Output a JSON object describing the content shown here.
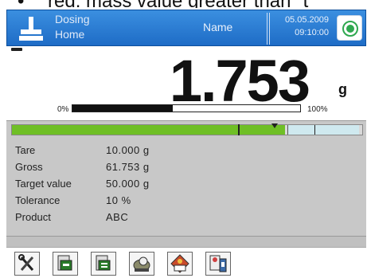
{
  "caption": {
    "bullet": "•",
    "text": "red: mass value greater than \"t"
  },
  "header": {
    "mode_line1": "Dosing",
    "mode_line2": "Home",
    "name_label": "Name",
    "date": "05.05.2009",
    "time": "09:10:00",
    "status_color": "#2fa84f",
    "icon": "scale-weighing-icon"
  },
  "display": {
    "value": "1.753",
    "unit": "g",
    "bar_min_label": "0%",
    "bar_max_label": "100%",
    "bar_fill_fraction": 0.44
  },
  "threshold_bar": {
    "green_fraction": 0.78,
    "colors": {
      "progress": "#6fbf26",
      "target_zone": "#cfe9ef"
    }
  },
  "info": [
    {
      "label": "Tare",
      "value": "10.000 g"
    },
    {
      "label": "Gross",
      "value": "61.753 g"
    },
    {
      "label": "Target value",
      "value": "50.000 g"
    },
    {
      "label": "Tolerance",
      "value": "10 %"
    },
    {
      "label": "Product",
      "value": "ABC"
    }
  ],
  "toolbar": [
    {
      "icon": "tools-icon"
    },
    {
      "icon": "tare-scale-icon"
    },
    {
      "icon": "zero-scale-icon"
    },
    {
      "icon": "database-icon"
    },
    {
      "icon": "cdb-product-icon"
    },
    {
      "icon": "printer-user-icon"
    }
  ]
}
